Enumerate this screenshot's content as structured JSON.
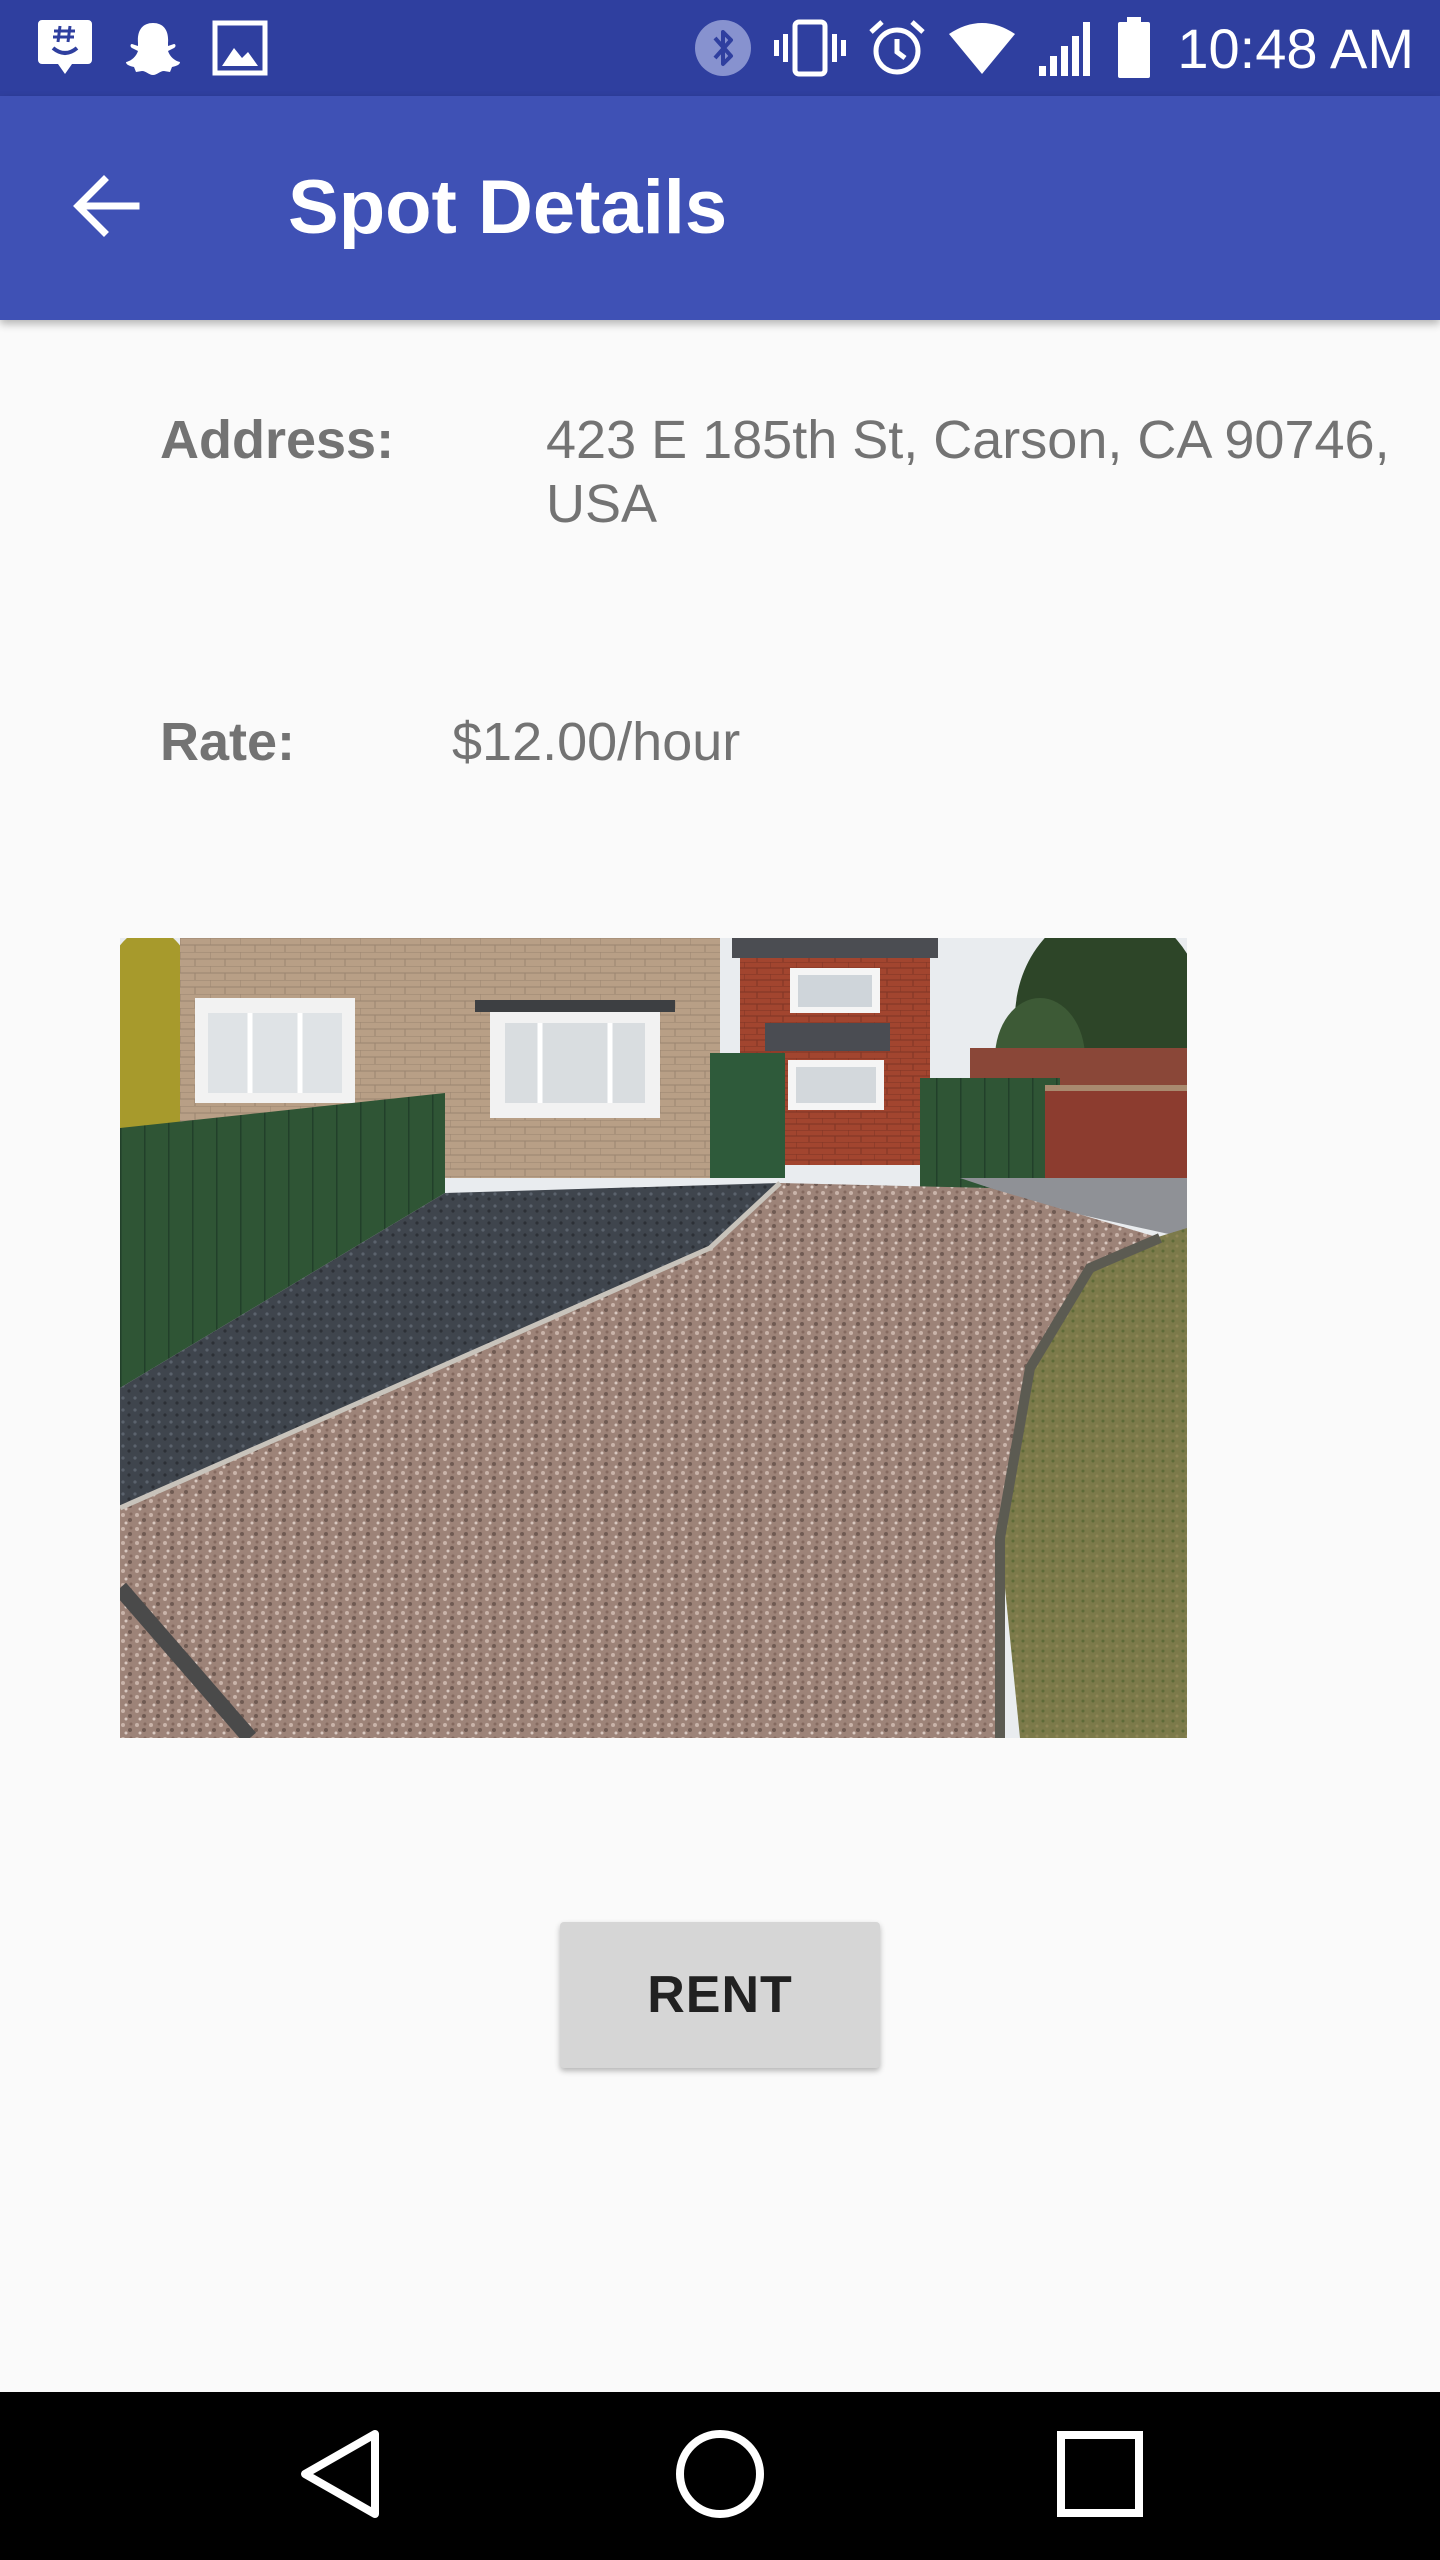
{
  "status_bar": {
    "time": "10:48 AM",
    "left_icons": [
      "groupme-icon",
      "snapchat-icon",
      "gallery-icon"
    ],
    "right_icons": [
      "bluetooth-icon",
      "vibrate-icon",
      "alarm-icon",
      "wifi-icon",
      "signal-icon",
      "battery-icon"
    ]
  },
  "app_bar": {
    "title": "Spot Details",
    "back_icon": "arrow-back-icon"
  },
  "details": {
    "address_label": "Address:",
    "address_value": "423 E 185th St, Carson, CA 90746, USA",
    "rate_label": "Rate:",
    "rate_value": "$12.00/hour"
  },
  "rent_button_label": "RENT",
  "nav_bar": {
    "icons": [
      "nav-back-icon",
      "nav-home-icon",
      "nav-recents-icon"
    ]
  },
  "colors": {
    "status_bar": "#2f3f9f",
    "app_bar": "#3f51b5",
    "background": "#fafafa",
    "label_text": "#737373",
    "button_bg": "#d6d6d6"
  }
}
